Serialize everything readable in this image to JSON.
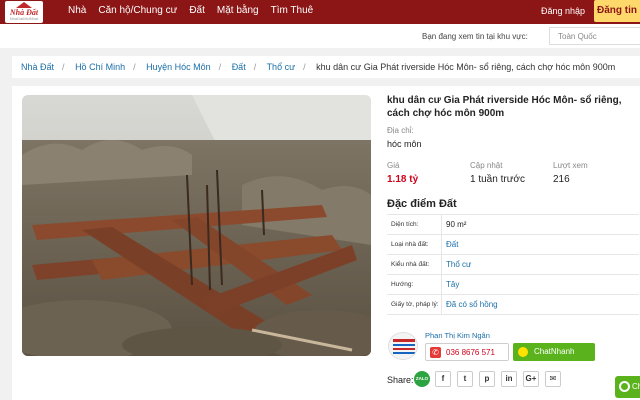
{
  "logo": {
    "brand": "Nhà Đất",
    "tagline": "NhaDatMoiNhat"
  },
  "nav": [
    "Nhà",
    "Căn hộ/Chung cư",
    "Đất",
    "Mặt bằng",
    "Tìm Thuê"
  ],
  "header": {
    "login": "Đăng nhập",
    "signup": "Đăng tin"
  },
  "view_area": {
    "label": "Bạn đang xem tin tại khu vực:",
    "value": "Toàn Quốc"
  },
  "breadcrumb": [
    "Nhà Đất",
    "Hồ Chí Minh",
    "Huyện Hóc Môn",
    "Đất",
    "Thổ cư"
  ],
  "breadcrumb_current": "khu dân cư Gia Phát riverside Hóc Môn- sổ riêng, cách chợ hóc môn 900m",
  "listing": {
    "title": "khu dân cư Gia Phát riverside Hóc Môn- sổ riêng, cách chợ hóc môn 900m",
    "address_label": "Địa chỉ:",
    "address": "hóc môn",
    "price_label": "Giá",
    "price": "1.18 tỷ",
    "updated_label": "Cập nhật",
    "updated": "1 tuần trước",
    "views_label": "Lượt xem",
    "views": "216"
  },
  "features": {
    "title": "Đặc điểm Đất",
    "rows": [
      {
        "key": "Diện tích:",
        "value": "90 m²"
      },
      {
        "key": "Loại nhà đất:",
        "value": "Đất"
      },
      {
        "key": "Kiểu nhà đất:",
        "value": "Thổ cư"
      },
      {
        "key": "Hướng:",
        "value": "Tây"
      },
      {
        "key": "Giấy tờ, pháp lý:",
        "value": "Đã có sổ hồng"
      }
    ]
  },
  "seller": {
    "name": "Phan Thị Kim Ngân",
    "phone": "036 8676 571",
    "chat": "ChatNhanh"
  },
  "share": {
    "label": "Share:",
    "zalo": "ZALO",
    "icons": [
      "f",
      "t",
      "p",
      "in",
      "G+",
      "✉"
    ]
  },
  "floating_chat": {
    "label": "Ch"
  },
  "colors": {
    "brand": "#8c1515",
    "accent": "#ffd86b",
    "price": "#d0021b",
    "link": "#1a6fa8",
    "chat": "#5ab31d"
  }
}
